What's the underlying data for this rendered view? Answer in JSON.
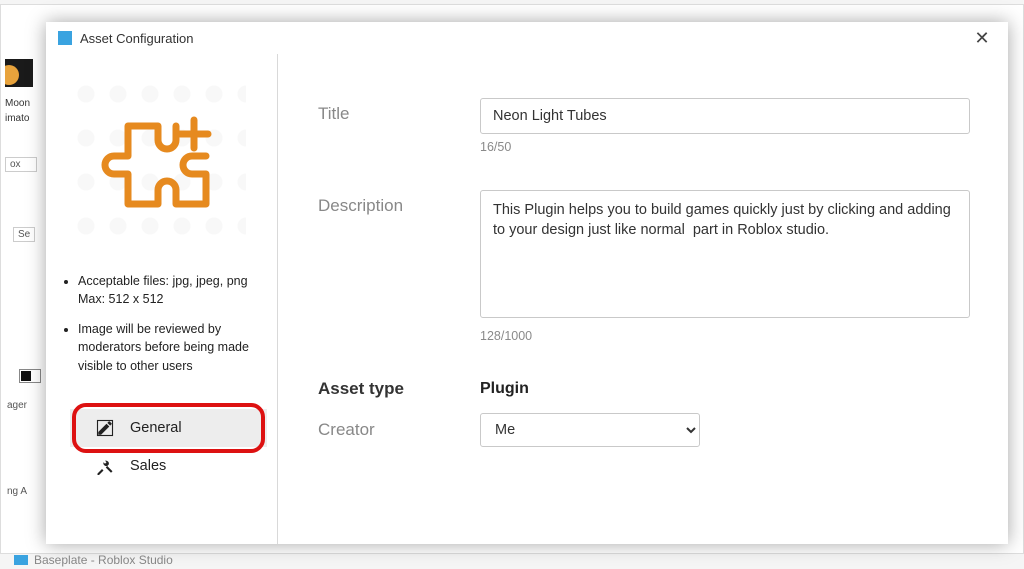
{
  "background": {
    "plugin_name_line1": "Moon",
    "plugin_name_line2": "imato",
    "box_label": "ox",
    "search_prefix": "Se",
    "toolbox_tab": "ager",
    "bottom_tab": "ng A",
    "taskbar_title": "Baseplate - Roblox Studio"
  },
  "dialog": {
    "title": "Asset Configuration",
    "close_glyph": "✕"
  },
  "left": {
    "accept_label": "Acceptable files: jpg, jpeg, png",
    "accept_sub": "Max: 512 x 512",
    "review_note": "Image will be reviewed by moderators before being made visible to other users",
    "tab_general": "General",
    "tab_sales": "Sales"
  },
  "form": {
    "title_label": "Title",
    "title_value": "Neon Light Tubes",
    "title_counter": "16/50",
    "desc_label": "Description",
    "desc_value": "This Plugin helps you to build games quickly just by clicking and adding to your design just like normal  part in Roblox studio.",
    "desc_counter": "128/1000",
    "asset_type_label": "Asset type",
    "asset_type_value": "Plugin",
    "creator_label": "Creator",
    "creator_value": "Me"
  }
}
